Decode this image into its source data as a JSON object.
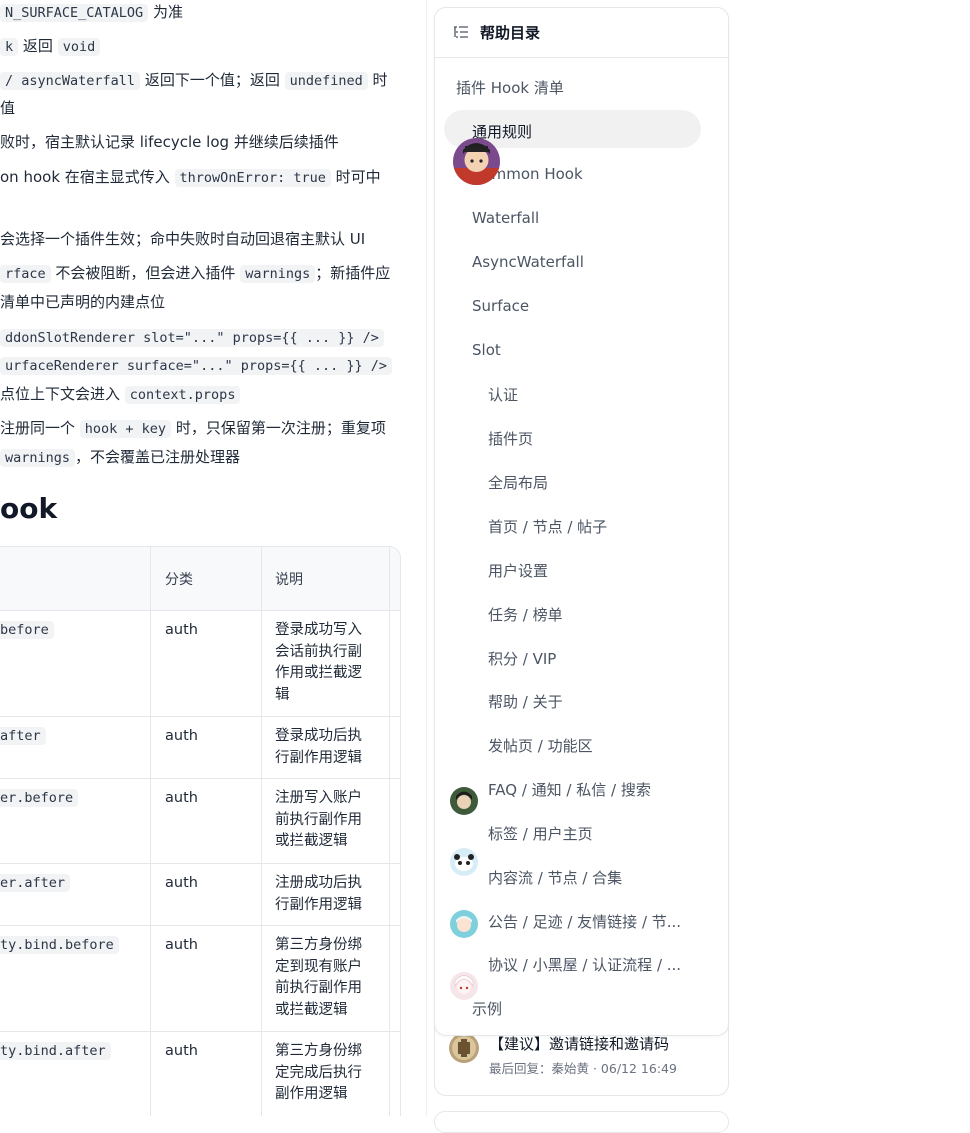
{
  "doc": {
    "lines": [
      {
        "parts": [
          {
            "code": "N_SURFACE_CATALOG"
          },
          {
            "text": " 为准"
          }
        ]
      },
      {
        "parts": [
          {
            "code": "k"
          },
          {
            "text": " 返回 "
          },
          {
            "code": "void"
          }
        ]
      },
      {
        "parts": [
          {
            "code": "/ asyncWaterfall"
          },
          {
            "text": " 返回下一个值；返回 "
          },
          {
            "code": "undefined"
          },
          {
            "text": " 时"
          }
        ]
      },
      {
        "parts": [
          {
            "text": "值"
          }
        ]
      },
      {
        "parts": [
          {
            "text": "败时，宿主默认记录 lifecycle log 并继续后续插件"
          }
        ]
      },
      {
        "parts": [
          {
            "text": "on hook 在宿主显式传入 "
          },
          {
            "code": "throwOnError: true"
          },
          {
            "text": " 时可中"
          }
        ]
      },
      {
        "parts": [
          {
            "text": "会选择一个插件生效；命中失败时自动回退宿主默认 UI"
          }
        ]
      },
      {
        "parts": [
          {
            "code": "rface"
          },
          {
            "text": " 不会被阻断，但会进入插件 "
          },
          {
            "code": "warnings"
          },
          {
            "text": "；新插件应"
          }
        ]
      },
      {
        "parts": [
          {
            "text": "清单中已声明的内建点位"
          }
        ]
      },
      {
        "parts": [
          {
            "code": "ddonSlotRenderer slot=\"...\" props={{ ... }} />"
          }
        ]
      },
      {
        "parts": [
          {
            "code": "urfaceRenderer surface=\"...\" props={{ ... }} />"
          }
        ]
      },
      {
        "parts": [
          {
            "text": "点位上下文会进入 "
          },
          {
            "code": "context.props"
          }
        ]
      },
      {
        "parts": [
          {
            "text": "注册同一个 "
          },
          {
            "code": "hook + key"
          },
          {
            "text": " 时，只保留第一次注册；重复项"
          }
        ]
      },
      {
        "parts": [
          {
            "code": "warnings"
          },
          {
            "text": "，不会覆盖已注册处理器"
          }
        ]
      }
    ],
    "heading": "ook",
    "table": {
      "headers": [
        "",
        "分类",
        "说明"
      ],
      "rows": [
        {
          "hook": "before",
          "category": "auth",
          "desc": "登录成功写入会话前执行副作用或拦截逻辑"
        },
        {
          "hook": "after",
          "category": "auth",
          "desc": "登录成功后执行副作用逻辑"
        },
        {
          "hook": "er.before",
          "category": "auth",
          "desc": "注册写入账户前执行副作用或拦截逻辑"
        },
        {
          "hook": "er.after",
          "category": "auth",
          "desc": "注册成功后执行副作用逻辑"
        },
        {
          "hook": "ty.bind.before",
          "category": "auth",
          "desc": "第三方身份绑定到现有账户前执行副作用或拦截逻辑"
        },
        {
          "hook": "ty.bind.after",
          "category": "auth",
          "desc": "第三方身份绑定完成后执行副作用逻辑"
        }
      ]
    }
  },
  "toc": {
    "title": "帮助目录",
    "icon": "list-tree-icon",
    "items": [
      {
        "label": "插件 Hook 清单",
        "level": 1
      },
      {
        "label": "通用规则",
        "level": 2,
        "active": true
      },
      {
        "label": "Common Hook",
        "level": 2
      },
      {
        "label": "Waterfall",
        "level": 2
      },
      {
        "label": "AsyncWaterfall",
        "level": 2
      },
      {
        "label": "Surface",
        "level": 2
      },
      {
        "label": "Slot",
        "level": 2
      },
      {
        "label": "认证",
        "level": 3
      },
      {
        "label": "插件页",
        "level": 3
      },
      {
        "label": "全局布局",
        "level": 3
      },
      {
        "label": "首页 / 节点 / 帖子",
        "level": 3
      },
      {
        "label": "用户设置",
        "level": 3
      },
      {
        "label": "任务 / 榜单",
        "level": 3
      },
      {
        "label": "积分 / VIP",
        "level": 3
      },
      {
        "label": "帮助 / 关于",
        "level": 3
      },
      {
        "label": "发帖页 / 功能区",
        "level": 3
      },
      {
        "label": "FAQ / 通知 / 私信 / 搜索",
        "level": 3
      },
      {
        "label": "标签 / 用户主页",
        "level": 3
      },
      {
        "label": "内容流 / 节点 / 合集",
        "level": 3
      },
      {
        "label": "公告 / 足迹 / 友情链接 / 节...",
        "level": 3
      },
      {
        "label": "协议 / 小黑屋 / 认证流程 / ...",
        "level": 3
      },
      {
        "label": "示例",
        "level": 2
      }
    ]
  },
  "card": {
    "title": "【建议】邀请链接和邀请码",
    "meta": "最后回复：秦始黄 · 06/12 16:49"
  },
  "colors": {
    "accent": "#111827",
    "active_bg": "#f1f1f1",
    "border": "#e5e7eb"
  }
}
